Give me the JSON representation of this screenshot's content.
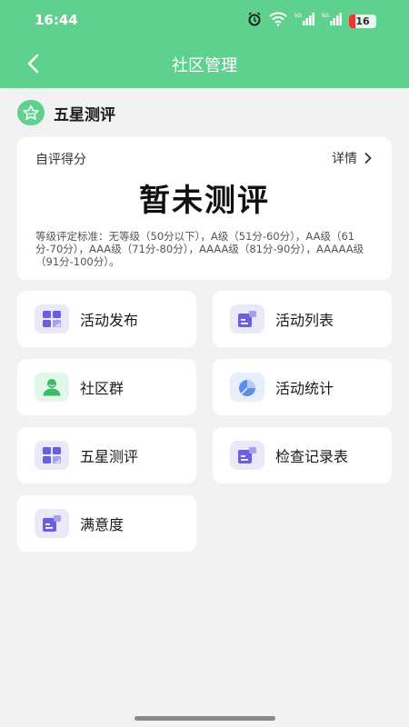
{
  "status_bar": {
    "time": "16:44",
    "battery": "16",
    "signal_label": "5G"
  },
  "header": {
    "title": "社区管理"
  },
  "section": {
    "title": "五星测评"
  },
  "score_card": {
    "label": "自评得分",
    "detail_label": "详情",
    "value": "暂未测评",
    "standard_text": "等级评定标准：无等级（50分以下），A级（51分-60分），AA级（61分-70分），AAA级（71分-80分），AAAA级（81分-90分），AAAAA级（91分-100分）。"
  },
  "menu": {
    "items": [
      {
        "label": "活动发布",
        "icon": "grid-icon"
      },
      {
        "label": "活动列表",
        "icon": "list-card-icon"
      },
      {
        "label": "社区群",
        "icon": "user-group-icon"
      },
      {
        "label": "活动统计",
        "icon": "pie-chart-icon"
      },
      {
        "label": "五星测评",
        "icon": "grid-icon"
      },
      {
        "label": "检查记录表",
        "icon": "list-card-icon"
      },
      {
        "label": "满意度",
        "icon": "list-card-icon"
      }
    ]
  },
  "colors": {
    "brand": "#5fd18e",
    "icon_bg": "#e9e9f7",
    "icon_fg": "#6a5fe0",
    "green_icon_bg": "#e3f6ea",
    "green_icon_fg": "#3fb86e"
  }
}
